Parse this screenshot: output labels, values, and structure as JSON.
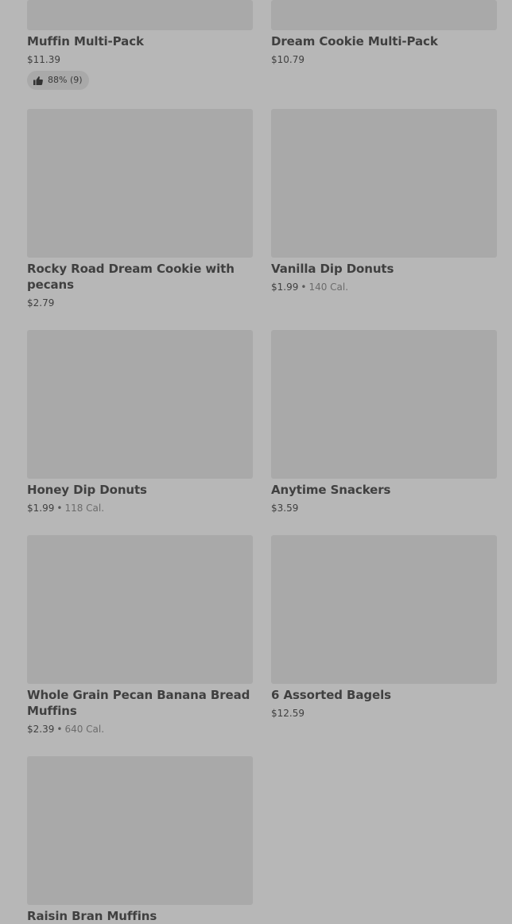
{
  "products": [
    {
      "name": "Muffin Multi-Pack",
      "price": "$11.39",
      "calories": "",
      "rating": "88% (9)"
    },
    {
      "name": "Dream Cookie Multi-Pack",
      "price": "$10.79",
      "calories": ""
    },
    {
      "name": "Rocky Road Dream Cookie with pecans",
      "price": "$2.79",
      "calories": ""
    },
    {
      "name": "Vanilla Dip Donuts",
      "price": "$1.99",
      "calories": "140 Cal."
    },
    {
      "name": "Honey Dip Donuts",
      "price": "$1.99",
      "calories": "118 Cal."
    },
    {
      "name": "Anytime Snackers",
      "price": "$3.59",
      "calories": ""
    },
    {
      "name": "Whole Grain Pecan Banana Bread Muffins",
      "price": "$2.39",
      "calories": "640 Cal."
    },
    {
      "name": "6 Assorted Bagels",
      "price": "$12.59",
      "calories": ""
    },
    {
      "name": "Raisin Bran Muffins",
      "price": "",
      "calories": ""
    }
  ],
  "separator": "•",
  "icons": {
    "rating": "thumbs-up-icon"
  },
  "colors": {
    "background": "#b7b7b7",
    "placeholder": "#a9a9a9"
  }
}
